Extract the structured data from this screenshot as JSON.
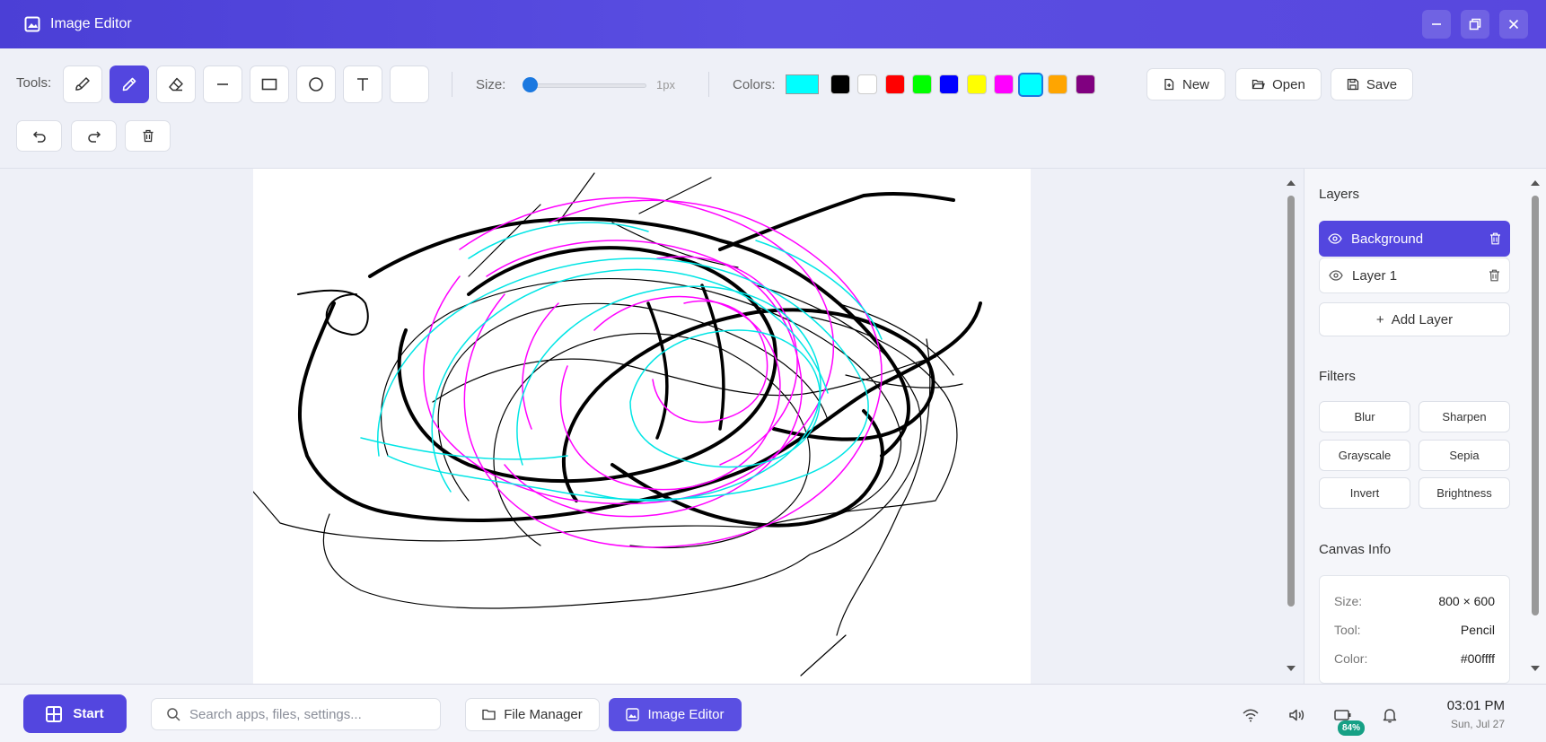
{
  "window": {
    "title": "Image Editor"
  },
  "toolbar": {
    "tools_label": "Tools:",
    "tools": [
      {
        "name": "brush",
        "active": false
      },
      {
        "name": "pencil",
        "active": true
      },
      {
        "name": "eraser",
        "active": false
      },
      {
        "name": "line",
        "active": false
      },
      {
        "name": "rectangle",
        "active": false
      },
      {
        "name": "circle",
        "active": false
      },
      {
        "name": "text",
        "active": false
      },
      {
        "name": "fill",
        "active": false
      }
    ],
    "size_label": "Size:",
    "size_value": "1px",
    "size_fraction": 0.0,
    "colors_label": "Colors:",
    "current_color": "#00ffff",
    "palette": [
      "#000000",
      "#ffffff",
      "#ff0000",
      "#00ff00",
      "#0000ff",
      "#ffff00",
      "#ff00ff",
      "#00ffff",
      "#ffa500",
      "#800080"
    ],
    "selected_color_index": 7,
    "new_label": "New",
    "open_label": "Open",
    "save_label": "Save"
  },
  "layers": {
    "heading": "Layers",
    "items": [
      {
        "label": "Background",
        "active": true
      },
      {
        "label": "Layer 1",
        "active": false
      }
    ],
    "add_label": "Add Layer"
  },
  "filters": {
    "heading": "Filters",
    "items": [
      "Blur",
      "Sharpen",
      "Grayscale",
      "Sepia",
      "Invert",
      "Brightness"
    ]
  },
  "canvas_info": {
    "heading": "Canvas Info",
    "size_key": "Size:",
    "size_value": "800 × 600",
    "tool_key": "Tool:",
    "tool_value": "Pencil",
    "color_key": "Color:",
    "color_value": "#00ffff"
  },
  "taskbar": {
    "start_label": "Start",
    "search_placeholder": "Search apps, files, settings...",
    "apps": [
      {
        "label": "File Manager",
        "active": false
      },
      {
        "label": "Image Editor",
        "active": true
      }
    ],
    "battery": "84%",
    "time": "03:01 PM",
    "date": "Sun, Jul 27"
  }
}
